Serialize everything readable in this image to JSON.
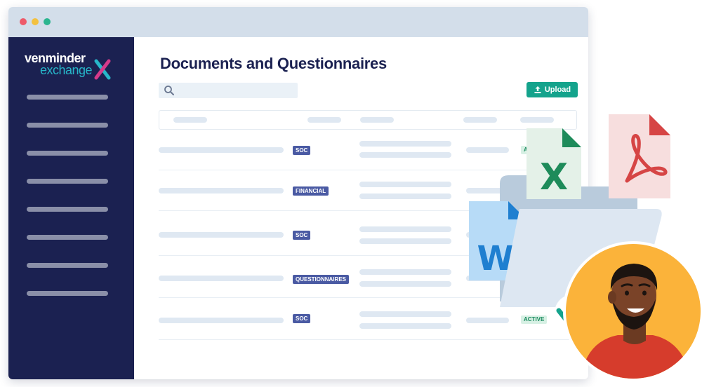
{
  "app": {
    "brand_line1": "venminder",
    "brand_line2": "exchange",
    "title": "Documents and Questionnaires"
  },
  "sidebar": {
    "items": [
      {
        "label": ""
      },
      {
        "label": ""
      },
      {
        "label": ""
      },
      {
        "label": ""
      },
      {
        "label": ""
      },
      {
        "label": ""
      },
      {
        "label": ""
      },
      {
        "label": ""
      }
    ]
  },
  "search": {
    "placeholder": ""
  },
  "toolbar": {
    "upload_label": "Upload"
  },
  "table": {
    "rows": [
      {
        "tag": "SOC",
        "status": "ACTIVE"
      },
      {
        "tag": "FINANCIAL",
        "status": ""
      },
      {
        "tag": "SOC",
        "status": ""
      },
      {
        "tag": "QUESTIONNAIRES",
        "status": ""
      },
      {
        "tag": "SOC",
        "status": "ACTIVE"
      }
    ]
  },
  "illustration": {
    "excel_letter": "X",
    "word_letter": "W",
    "icons": [
      "excel-file-icon",
      "pdf-file-icon",
      "word-file-icon",
      "folder-icon",
      "checkmark-icon",
      "person-avatar"
    ]
  },
  "colors": {
    "sidebar": "#1b2151",
    "accent": "#14a38c",
    "tag": "#4a5aa3",
    "titlebar": "#d3deea",
    "dot_red": "#ee5a6a",
    "dot_yellow": "#f3c140",
    "dot_green": "#2bb58f"
  }
}
